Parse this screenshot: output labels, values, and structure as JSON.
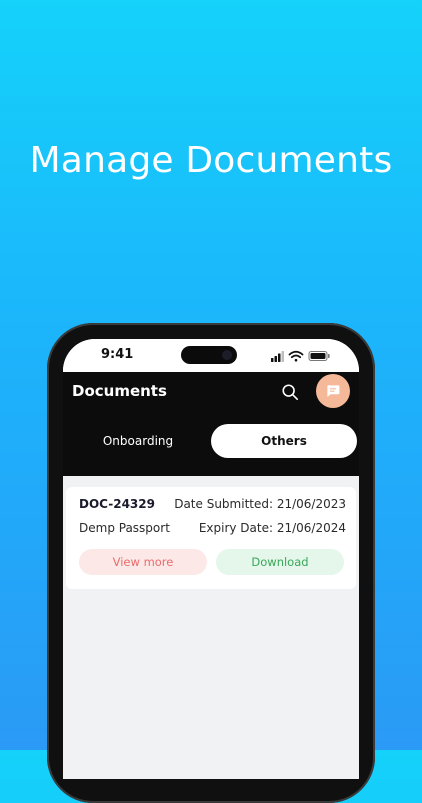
{
  "promo": {
    "headline": "Manage Documents"
  },
  "status_bar": {
    "time": "9:41"
  },
  "header": {
    "title": "Documents",
    "icons": [
      "search-icon",
      "chat-icon"
    ]
  },
  "tabs": [
    {
      "label": "Onboarding",
      "selected": false
    },
    {
      "label": "Others",
      "selected": true
    }
  ],
  "documents": [
    {
      "id": "DOC-24329",
      "date_submitted": "Date Submitted: 21/06/2023",
      "name": "Demp Passport",
      "expiry_date": "Expiry Date: 21/06/2024",
      "view_label": "View more",
      "download_label": "Download"
    }
  ],
  "colors": {
    "background_top": "#14d2fa",
    "background_bottom": "#2a9af6",
    "header_bg": "#0c0c0c",
    "chat_button": "#f5b999",
    "view_more_bg": "#fde8e8",
    "view_more_text": "#ea6b6b",
    "download_bg": "#e5f6ea",
    "download_text": "#39a85a"
  }
}
